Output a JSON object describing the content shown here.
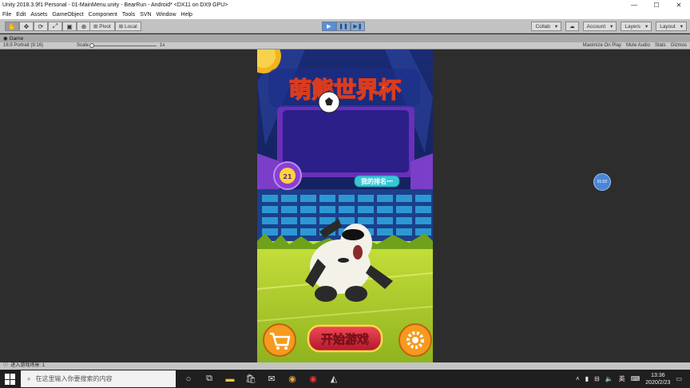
{
  "window": {
    "title": "Unity 2018.3.9f1 Personal - 01-MainMenu.unity - BearRun - Android* <DX11 on DX9 GPU>",
    "controls": [
      "—",
      "☐",
      "✕"
    ]
  },
  "menu": [
    "File",
    "Edit",
    "Assets",
    "GameObject",
    "Component",
    "Tools",
    "SVN",
    "Window",
    "Help"
  ],
  "toolbar": {
    "pivot_label": "Pivot",
    "local_label": "Local",
    "collab_label": "Collab",
    "account_label": "Account",
    "layers_label": "Layers",
    "layout_label": "Layout"
  },
  "tab": {
    "label": "Game"
  },
  "gamebar": {
    "resolution": "16:9 Portrait (9:16)",
    "scale_label": "Scale",
    "scale_value": "1x",
    "options": [
      "Maximize On Play",
      "Mute Audio",
      "Stats",
      "Gizmos"
    ]
  },
  "game": {
    "title": "萌熊世界杯",
    "rank_label": "我的排名一",
    "badge_text": "21",
    "start_label": "开始游戏"
  },
  "overlay_bubble": "01:02",
  "status": {
    "text": "进入游戏场景: 1"
  },
  "taskbar": {
    "search_placeholder": "在这里输入你要搜索的内容",
    "time": "13:36",
    "date": "2020/2/23",
    "ime": "英"
  },
  "colors": {
    "play_active": "#5b8ed6",
    "game_bg_top": "#1a2a6b",
    "field_green": "#b6d43a",
    "start_button_red": "#d8283a"
  }
}
